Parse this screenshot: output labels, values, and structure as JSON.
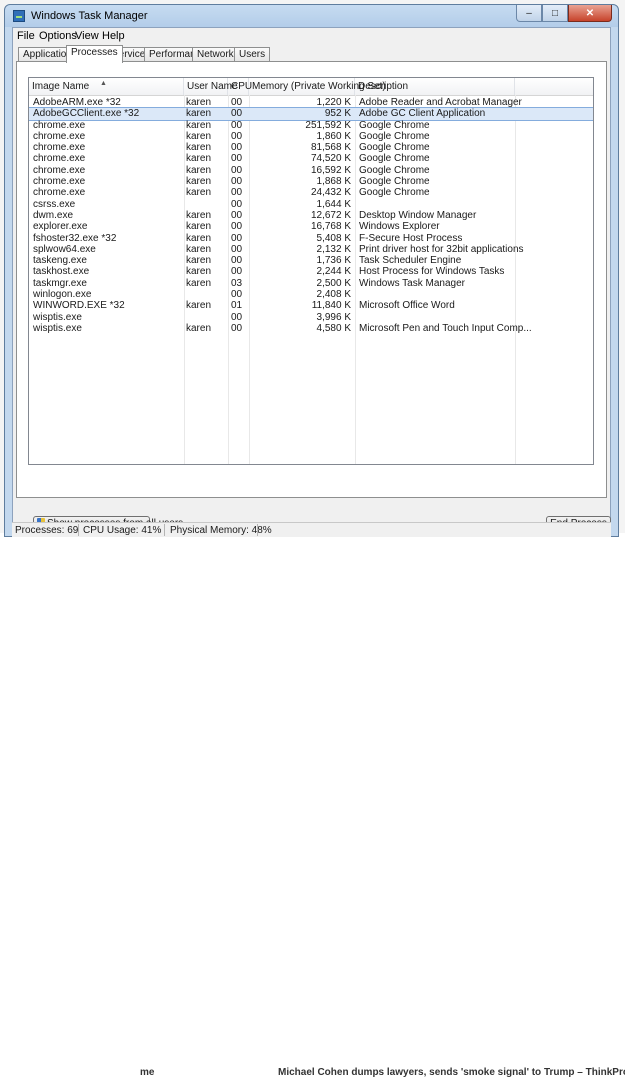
{
  "background": {
    "left_text": "me",
    "right_text": "Michael Cohen dumps lawyers, sends 'smoke signal' to Trump – ThinkProgress"
  },
  "window": {
    "title": "Windows Task Manager",
    "buttons": {
      "minimize": "–",
      "maximize": "□",
      "close": "✕"
    }
  },
  "menu": [
    "File",
    "Options",
    "View",
    "Help"
  ],
  "tabs": [
    "Applications",
    "Processes",
    "Services",
    "Performance",
    "Networking",
    "Users"
  ],
  "active_tab": "Processes",
  "columns": {
    "name": "Image Name",
    "user": "User Name",
    "cpu": "CPU",
    "memory": "Memory (Private Working Set)",
    "description": "Description"
  },
  "processes": [
    {
      "name": "AdobeARM.exe *32",
      "user": "karen",
      "cpu": "00",
      "memory": "1,220 K",
      "description": "Adobe Reader and Acrobat Manager"
    },
    {
      "name": "AdobeGCClient.exe *32",
      "user": "karen",
      "cpu": "00",
      "memory": "952 K",
      "description": "Adobe GC Client Application"
    },
    {
      "name": "chrome.exe",
      "user": "karen",
      "cpu": "00",
      "memory": "251,592 K",
      "description": "Google Chrome"
    },
    {
      "name": "chrome.exe",
      "user": "karen",
      "cpu": "00",
      "memory": "1,860 K",
      "description": "Google Chrome"
    },
    {
      "name": "chrome.exe",
      "user": "karen",
      "cpu": "00",
      "memory": "81,568 K",
      "description": "Google Chrome"
    },
    {
      "name": "chrome.exe",
      "user": "karen",
      "cpu": "00",
      "memory": "74,520 K",
      "description": "Google Chrome"
    },
    {
      "name": "chrome.exe",
      "user": "karen",
      "cpu": "00",
      "memory": "16,592 K",
      "description": "Google Chrome"
    },
    {
      "name": "chrome.exe",
      "user": "karen",
      "cpu": "00",
      "memory": "1,868 K",
      "description": "Google Chrome"
    },
    {
      "name": "chrome.exe",
      "user": "karen",
      "cpu": "00",
      "memory": "24,432 K",
      "description": "Google Chrome"
    },
    {
      "name": "csrss.exe",
      "user": "",
      "cpu": "00",
      "memory": "1,644 K",
      "description": ""
    },
    {
      "name": "dwm.exe",
      "user": "karen",
      "cpu": "00",
      "memory": "12,672 K",
      "description": "Desktop Window Manager"
    },
    {
      "name": "explorer.exe",
      "user": "karen",
      "cpu": "00",
      "memory": "16,768 K",
      "description": "Windows Explorer"
    },
    {
      "name": "fshoster32.exe *32",
      "user": "karen",
      "cpu": "00",
      "memory": "5,408 K",
      "description": "F-Secure Host Process"
    },
    {
      "name": "splwow64.exe",
      "user": "karen",
      "cpu": "00",
      "memory": "2,132 K",
      "description": "Print driver host for 32bit applications"
    },
    {
      "name": "taskeng.exe",
      "user": "karen",
      "cpu": "00",
      "memory": "1,736 K",
      "description": "Task Scheduler Engine"
    },
    {
      "name": "taskhost.exe",
      "user": "karen",
      "cpu": "00",
      "memory": "2,244 K",
      "description": "Host Process for Windows Tasks"
    },
    {
      "name": "taskmgr.exe",
      "user": "karen",
      "cpu": "03",
      "memory": "2,500 K",
      "description": "Windows Task Manager"
    },
    {
      "name": "winlogon.exe",
      "user": "",
      "cpu": "00",
      "memory": "2,408 K",
      "description": ""
    },
    {
      "name": "WINWORD.EXE *32",
      "user": "karen",
      "cpu": "01",
      "memory": "11,840 K",
      "description": "Microsoft Office Word"
    },
    {
      "name": "wisptis.exe",
      "user": "",
      "cpu": "00",
      "memory": "3,996 K",
      "description": ""
    },
    {
      "name": "wisptis.exe",
      "user": "karen",
      "cpu": "00",
      "memory": "4,580 K",
      "description": "Microsoft Pen and Touch Input Comp..."
    }
  ],
  "selected_row": 1,
  "buttons": {
    "show_all": "Show processes from all users",
    "end_process": "End Process"
  },
  "status": {
    "processes": "Processes: 69",
    "cpu": "CPU Usage: 41%",
    "memory": "Physical Memory: 48%"
  }
}
